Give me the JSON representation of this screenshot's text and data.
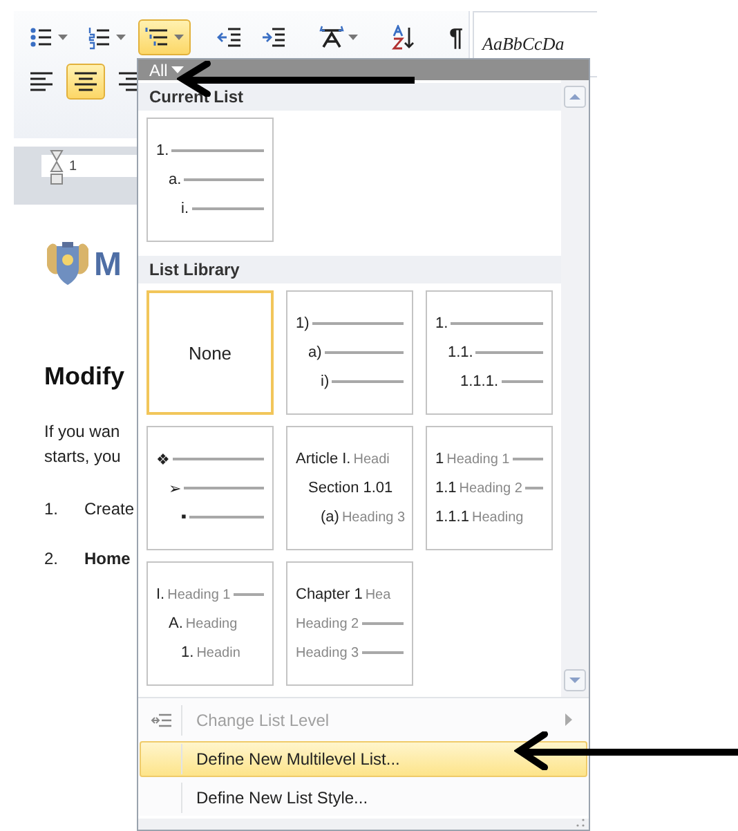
{
  "ribbon": {
    "rows": [
      [
        {
          "kind": "bullets",
          "dropdown": true,
          "selected": false
        },
        {
          "kind": "numbering",
          "dropdown": true,
          "selected": false
        },
        {
          "kind": "multilevel",
          "dropdown": true,
          "selected": true
        },
        {
          "kind": "separator"
        },
        {
          "kind": "outdent",
          "dropdown": false,
          "selected": false
        },
        {
          "kind": "indent",
          "dropdown": false,
          "selected": false
        },
        {
          "kind": "separator"
        },
        {
          "kind": "case",
          "dropdown": true,
          "selected": false
        },
        {
          "kind": "separator"
        },
        {
          "kind": "sort",
          "dropdown": false,
          "selected": false
        },
        {
          "kind": "separator"
        },
        {
          "kind": "glyph",
          "text": "¶",
          "dropdown": false,
          "selected": false
        }
      ],
      [
        {
          "kind": "align_left",
          "dropdown": false,
          "selected": false
        },
        {
          "kind": "align_center",
          "dropdown": false,
          "selected": true
        },
        {
          "kind": "align_right",
          "dropdown": false,
          "selected": false
        }
      ]
    ],
    "styles_sample": "AaBbCcDa",
    "ruler_mark": "1"
  },
  "document": {
    "logo_text": "M",
    "heading": "Modify",
    "paragraph": [
      "If you wan",
      "starts, you"
    ],
    "list": [
      {
        "number": "1.",
        "text": "Create",
        "bold": false
      },
      {
        "number": "2.",
        "text": "Home",
        "bold": true
      }
    ]
  },
  "dropdown": {
    "filter": "All",
    "sections": [
      {
        "title": "Current List",
        "tiles": [
          {
            "kind": "indented",
            "selected": false,
            "lines": [
              {
                "number": "1.",
                "rule": true
              },
              {
                "number": "a.",
                "rule": true
              },
              {
                "number": "i.",
                "rule": true
              }
            ]
          }
        ]
      },
      {
        "title": "List Library",
        "tiles": [
          {
            "kind": "none",
            "label": "None",
            "selected": true
          },
          {
            "kind": "indented",
            "selected": false,
            "lines": [
              {
                "number": "1)",
                "rule": true
              },
              {
                "number": "a)",
                "rule": true
              },
              {
                "number": "i)",
                "rule": true
              }
            ]
          },
          {
            "kind": "indented",
            "selected": false,
            "lines": [
              {
                "number": "1.",
                "rule": true
              },
              {
                "number": "1.1.",
                "rule": true
              },
              {
                "number": "1.1.1.",
                "rule": true
              }
            ]
          },
          {
            "kind": "indented",
            "selected": false,
            "lines": [
              {
                "number": "❖",
                "rule": true
              },
              {
                "number": "➢",
                "rule": true
              },
              {
                "number": "▪",
                "rule": true
              }
            ]
          },
          {
            "kind": "indented",
            "selected": false,
            "lines": [
              {
                "number": "Article I.",
                "heading": "Headi",
                "rule": false
              },
              {
                "number": "Section 1.01",
                "rule": false
              },
              {
                "number": "(a)",
                "heading": "Heading 3",
                "rule": false
              }
            ]
          },
          {
            "kind": "flat",
            "selected": false,
            "lines": [
              {
                "number": "1",
                "heading": "Heading 1",
                "rule": true
              },
              {
                "number": "1.1",
                "heading": "Heading 2",
                "rule": true
              },
              {
                "number": "1.1.1",
                "heading": "Heading",
                "rule": false
              }
            ]
          },
          {
            "kind": "indented",
            "selected": false,
            "lines": [
              {
                "number": "I.",
                "heading": "Heading 1",
                "rule": true
              },
              {
                "number": "A.",
                "heading": "Heading",
                "rule": false
              },
              {
                "number": "1.",
                "heading": "Headin",
                "rule": false
              }
            ]
          },
          {
            "kind": "flat",
            "selected": false,
            "lines": [
              {
                "number": "Chapter 1",
                "heading": "Hea",
                "rule": false
              },
              {
                "heading": "Heading 2",
                "rule": true
              },
              {
                "heading": "Heading 3",
                "rule": true
              }
            ]
          }
        ]
      }
    ],
    "menu": [
      {
        "label": "Change List Level",
        "disabled": true,
        "highlighted": false,
        "icon": true,
        "submenu": true
      },
      {
        "label": "Define New Multilevel List...",
        "disabled": false,
        "highlighted": true,
        "icon": false,
        "submenu": false
      },
      {
        "label": "Define New List Style...",
        "disabled": false,
        "highlighted": false,
        "icon": false,
        "submenu": false
      }
    ]
  }
}
